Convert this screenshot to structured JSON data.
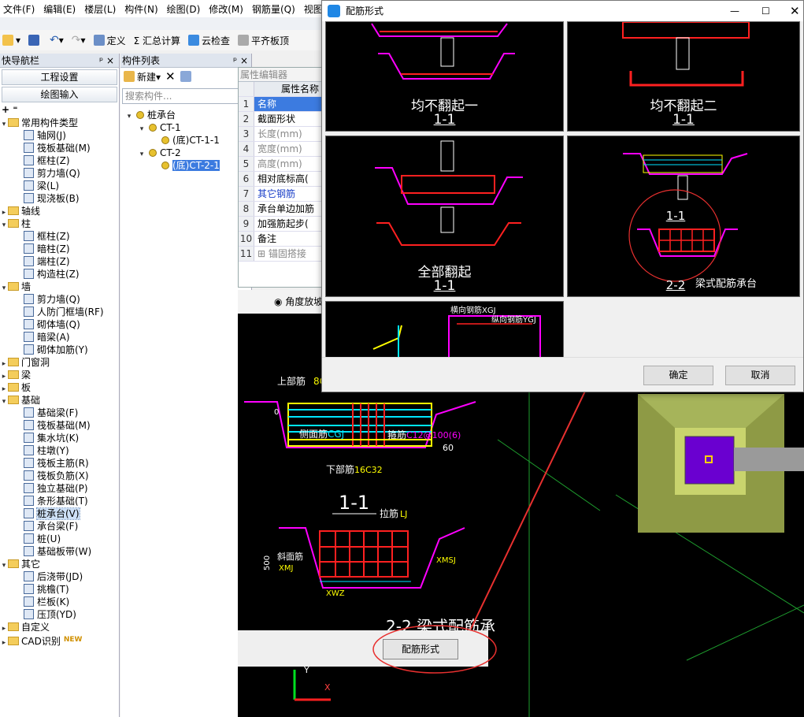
{
  "menu": [
    "文件(F)",
    "编辑(E)",
    "楼层(L)",
    "构件(N)",
    "绘图(D)",
    "修改(M)",
    "钢筋量(Q)",
    "视图(V)"
  ],
  "toolbar": {
    "define": "定义",
    "sum": "Σ 汇总计算",
    "cloud": "云检查",
    "flat": "平齐板顶"
  },
  "nav": {
    "title": "快导航栏",
    "project_settings": "工程设置",
    "drawing_input": "绘图输入",
    "tree": [
      {
        "type": "folder",
        "level": 0,
        "label": "常用构件类型",
        "exp": "▾"
      },
      {
        "type": "leaf",
        "level": 1,
        "label": "轴网(J)"
      },
      {
        "type": "leaf",
        "level": 1,
        "label": "筏板基础(M)"
      },
      {
        "type": "leaf",
        "level": 1,
        "label": "框柱(Z)"
      },
      {
        "type": "leaf",
        "level": 1,
        "label": "剪力墙(Q)"
      },
      {
        "type": "leaf",
        "level": 1,
        "label": "梁(L)"
      },
      {
        "type": "leaf",
        "level": 1,
        "label": "现浇板(B)"
      },
      {
        "type": "folder",
        "level": 0,
        "label": "轴线",
        "exp": "▸"
      },
      {
        "type": "folder",
        "level": 0,
        "label": "柱",
        "exp": "▾"
      },
      {
        "type": "leaf",
        "level": 1,
        "label": "框柱(Z)"
      },
      {
        "type": "leaf",
        "level": 1,
        "label": "暗柱(Z)"
      },
      {
        "type": "leaf",
        "level": 1,
        "label": "端柱(Z)"
      },
      {
        "type": "leaf",
        "level": 1,
        "label": "构造柱(Z)"
      },
      {
        "type": "folder",
        "level": 0,
        "label": "墙",
        "exp": "▾"
      },
      {
        "type": "leaf",
        "level": 1,
        "label": "剪力墙(Q)"
      },
      {
        "type": "leaf",
        "level": 1,
        "label": "人防门框墙(RF)"
      },
      {
        "type": "leaf",
        "level": 1,
        "label": "砌体墙(Q)"
      },
      {
        "type": "leaf",
        "level": 1,
        "label": "暗梁(A)"
      },
      {
        "type": "leaf",
        "level": 1,
        "label": "砌体加筋(Y)"
      },
      {
        "type": "folder",
        "level": 0,
        "label": "门窗洞",
        "exp": "▸"
      },
      {
        "type": "folder",
        "level": 0,
        "label": "梁",
        "exp": "▸"
      },
      {
        "type": "folder",
        "level": 0,
        "label": "板",
        "exp": "▸"
      },
      {
        "type": "folder",
        "level": 0,
        "label": "基础",
        "exp": "▾"
      },
      {
        "type": "leaf",
        "level": 1,
        "label": "基础梁(F)"
      },
      {
        "type": "leaf",
        "level": 1,
        "label": "筏板基础(M)"
      },
      {
        "type": "leaf",
        "level": 1,
        "label": "集水坑(K)"
      },
      {
        "type": "leaf",
        "level": 1,
        "label": "柱墩(Y)"
      },
      {
        "type": "leaf",
        "level": 1,
        "label": "筏板主筋(R)"
      },
      {
        "type": "leaf",
        "level": 1,
        "label": "筏板负筋(X)"
      },
      {
        "type": "leaf",
        "level": 1,
        "label": "独立基础(P)"
      },
      {
        "type": "leaf",
        "level": 1,
        "label": "条形基础(T)"
      },
      {
        "type": "leaf",
        "level": 1,
        "label": "桩承台(V)",
        "selected": true
      },
      {
        "type": "leaf",
        "level": 1,
        "label": "承台梁(F)"
      },
      {
        "type": "leaf",
        "level": 1,
        "label": "桩(U)"
      },
      {
        "type": "leaf",
        "level": 1,
        "label": "基础板带(W)"
      },
      {
        "type": "folder",
        "level": 0,
        "label": "其它",
        "exp": "▾"
      },
      {
        "type": "leaf",
        "level": 1,
        "label": "后浇带(JD)"
      },
      {
        "type": "leaf",
        "level": 1,
        "label": "挑檐(T)"
      },
      {
        "type": "leaf",
        "level": 1,
        "label": "栏板(K)"
      },
      {
        "type": "leaf",
        "level": 1,
        "label": "压顶(YD)"
      },
      {
        "type": "folder",
        "level": 0,
        "label": "自定义",
        "exp": "▸"
      },
      {
        "type": "folder",
        "level": 0,
        "label": "CAD识别",
        "exp": "▸",
        "badge": "NEW"
      }
    ]
  },
  "comp": {
    "title": "构件列表",
    "new_label": "新建",
    "search_placeholder": "搜索构件...",
    "tree": [
      {
        "label": "桩承台",
        "level": 0
      },
      {
        "label": "CT-1",
        "level": 1
      },
      {
        "label": "(底)CT-1-1",
        "level": 2
      },
      {
        "label": "CT-2",
        "level": 1
      },
      {
        "label": "(底)CT-2-1",
        "level": 2,
        "selected": true
      }
    ]
  },
  "props": {
    "title": "属性编辑器",
    "header": "属性名称",
    "rows": [
      {
        "n": "1",
        "name": "名称",
        "style": "sel"
      },
      {
        "n": "2",
        "name": "截面形状"
      },
      {
        "n": "3",
        "name": "长度(mm)",
        "style": "gray"
      },
      {
        "n": "4",
        "name": "宽度(mm)",
        "style": "gray"
      },
      {
        "n": "5",
        "name": "高度(mm)",
        "style": "gray"
      },
      {
        "n": "6",
        "name": "相对底标高("
      },
      {
        "n": "7",
        "name": "其它钢筋",
        "style": "blue"
      },
      {
        "n": "8",
        "name": "承台单边加筋"
      },
      {
        "n": "9",
        "name": "加强筋起步("
      },
      {
        "n": "10",
        "name": "备注"
      },
      {
        "n": "11",
        "name": "⊞ 锚固搭接",
        "style": "gray"
      }
    ]
  },
  "radio_label": "角度放坡",
  "peijin_button": "配筋形式",
  "cad": {
    "top_label": "上部筋",
    "top_code": "8C",
    "side_label": "侧面筋",
    "side_code": "CGJ",
    "stirrup_label": "箍筋",
    "stirrup_code": "C12@100(6)",
    "bottom_label": "下部筋",
    "bottom_code": "16C32",
    "section1": "1-1",
    "tie_label": "拉筋",
    "tie_code": "LJ",
    "slope_label": "斜面筋",
    "slope_code": "XMJ",
    "xmsj": "XMSJ",
    "xwz": "XWZ",
    "dim500": "500",
    "dim60": "60",
    "dim0": "0",
    "title2": "2-2 梁式配筋承",
    "axis_y": "Y",
    "axis_x": "X"
  },
  "dialog": {
    "title": "配筋形式",
    "thumbs": [
      {
        "caption": "均不翻起一",
        "section": "1-1"
      },
      {
        "caption": "均不翻起二",
        "section": "1-1"
      },
      {
        "caption": "全部翻起",
        "section": "1-1"
      },
      {
        "caption": "梁式配筋承台",
        "section": "1-1",
        "section2": "2-2"
      },
      {
        "caption": "",
        "label_a": "横向钢筋XGJ",
        "label_b": "纵向钢筋YGJ"
      }
    ],
    "ok": "确定",
    "cancel": "取消"
  },
  "colors": {
    "accent": "#0078d7",
    "cad_bg": "#000000",
    "yellow": "#ffff00",
    "magenta": "#ff00ff",
    "red": "#ff0000",
    "annotation": "#e8302f"
  }
}
